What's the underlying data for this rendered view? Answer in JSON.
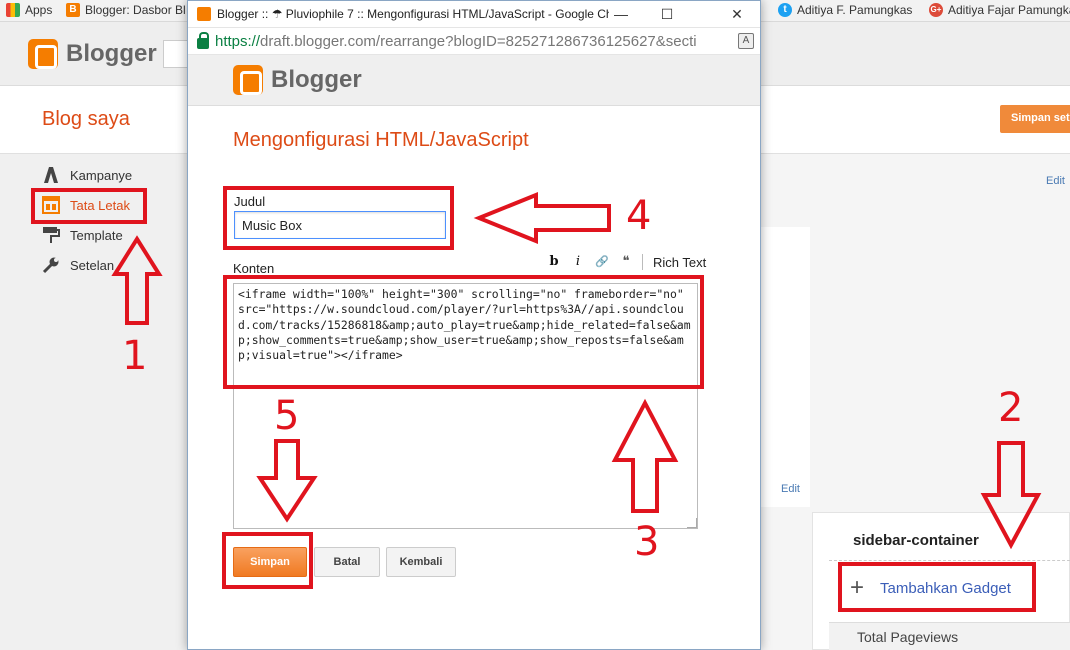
{
  "bookmarks": [
    {
      "label": "Apps",
      "icon": "apps-grid-icon"
    },
    {
      "label": "Blogger: Dasbor Bl",
      "icon": "blogger-icon"
    },
    {
      "label": "Aditiya F. Pamungkas",
      "icon": "twitter-icon"
    },
    {
      "label": "Aditiya Fajar Pamungka",
      "icon": "google-plus-icon"
    }
  ],
  "background": {
    "logo_text": "Blogger",
    "blog_saya": "Blog saya",
    "save_settings": "Simpan set",
    "nav": [
      {
        "label": "Kampanye",
        "icon": "campaign-icon",
        "active": false
      },
      {
        "label": "Tata Letak",
        "icon": "layout-icon",
        "active": true
      },
      {
        "label": "Template",
        "icon": "paint-roller-icon",
        "active": false
      },
      {
        "label": "Setelan",
        "icon": "wrench-icon",
        "active": false
      }
    ],
    "edit_label": "Edit",
    "sidebar_container": "sidebar-container",
    "add_gadget_plus": "+",
    "add_gadget": "Tambahkan Gadget",
    "total_pageviews": "Total Pageviews"
  },
  "popup": {
    "window_title": "Blogger :: ☂ Pluviophile 7 :: Mengonfigurasi HTML/JavaScript - Google Chr",
    "url_scheme": "https://",
    "url_rest": "draft.blogger.com/rearrange?blogID=825271286736125627&secti",
    "minimize": "—",
    "maximize": "☐",
    "close": "✕",
    "logo_text": "Blogger",
    "heading": "Mengonfigurasi HTML/JavaScript",
    "judul_label": "Judul",
    "judul_value": "Music Box",
    "konten_label": "Konten",
    "toolbar": {
      "bold": "b",
      "italic": "i",
      "link": "🔗",
      "quote": "❝",
      "rich_text": "Rich Text"
    },
    "content_code": "<iframe width=\"100%\" height=\"300\" scrolling=\"no\" frameborder=\"no\" src=\"https://w.soundcloud.com/player/?url=https%3A//api.soundcloud.com/tracks/15286818&amp;auto_play=true&amp;hide_related=false&amp;show_comments=true&amp;show_user=true&amp;show_reposts=false&amp;visual=true\"></iframe>",
    "buttons": {
      "save": "Simpan",
      "cancel": "Batal",
      "back": "Kembali"
    }
  },
  "annotations": [
    "1",
    "2",
    "3",
    "4",
    "5"
  ],
  "colors": {
    "blogger_orange": "#f57d00",
    "annotation_red": "#e0141e",
    "heading_orange": "#dd4b16",
    "link_blue": "#3b5eb8"
  }
}
